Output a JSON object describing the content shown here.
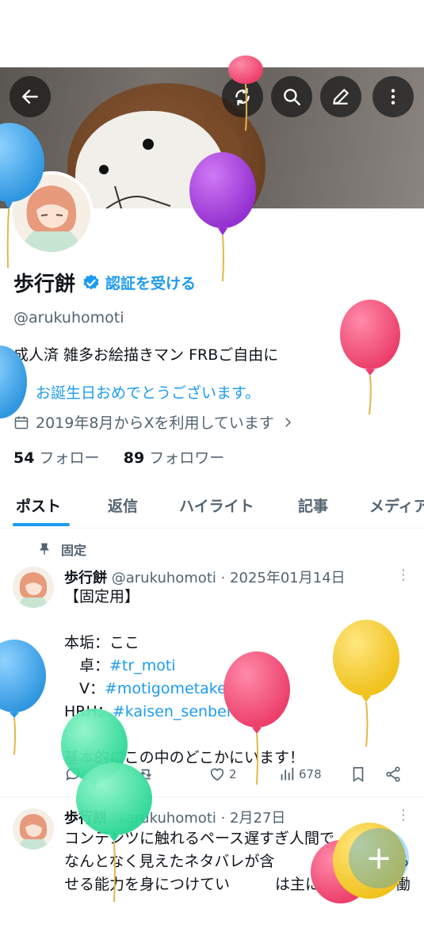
{
  "header": {
    "back_icon": "arrow-left-icon",
    "refresh_icon": "refresh-icon",
    "search_icon": "search-icon",
    "edit_icon": "pencil-icon",
    "more_icon": "more-vertical-icon"
  },
  "profile": {
    "name": "歩行餅",
    "verify_label": "認証を受ける",
    "handle": "@arukuhomoti",
    "bio": "成人済 雑多お絵描きマン FRBご自由に",
    "birthday": "お誕生日おめでとうございます。",
    "joined": "2019年8月からXを利用しています",
    "following_count": "54",
    "following_label": "フォロー",
    "followers_count": "89",
    "followers_label": "フォロワー"
  },
  "tabs": [
    "ポスト",
    "返信",
    "ハイライト",
    "記事",
    "メディア"
  ],
  "posts": [
    {
      "pinned_label": "固定",
      "author": "歩行餅",
      "meta": "@arukuhomoti · 2025年01月14日",
      "lines": [
        "【固定用】",
        "",
        "本垢：ここ"
      ],
      "tag_lines": [
        {
          "prefix": "　卓：",
          "tag": "#tr_moti"
        },
        {
          "prefix": "　V：",
          "tag": "#motigometaketa"
        },
        {
          "prefix": "HRH：",
          "tag": "#kaisen_senbei"
        }
      ],
      "last_line": "基本的にこの中のどこかにいます！",
      "likes": "2",
      "views": "678"
    },
    {
      "author": "歩行餅",
      "meta": "@arukuhomoti · 2月27日",
      "text": "コンテンツに触れるペース遅すぎ人間で　　ため、なんとなく見えたネタバレが含　　　の記憶を曇らせる能力を身につけてい　　　は主にイナズマに働いています"
    }
  ],
  "fab_label": "+",
  "colors": {
    "accent": "#1d9bf0",
    "balloon_pink": "#f0507a",
    "balloon_blue": "#3fa7e8",
    "balloon_purple": "#a13ed8",
    "balloon_yellow": "#f2cc2c",
    "balloon_green": "#3ddfa0"
  }
}
